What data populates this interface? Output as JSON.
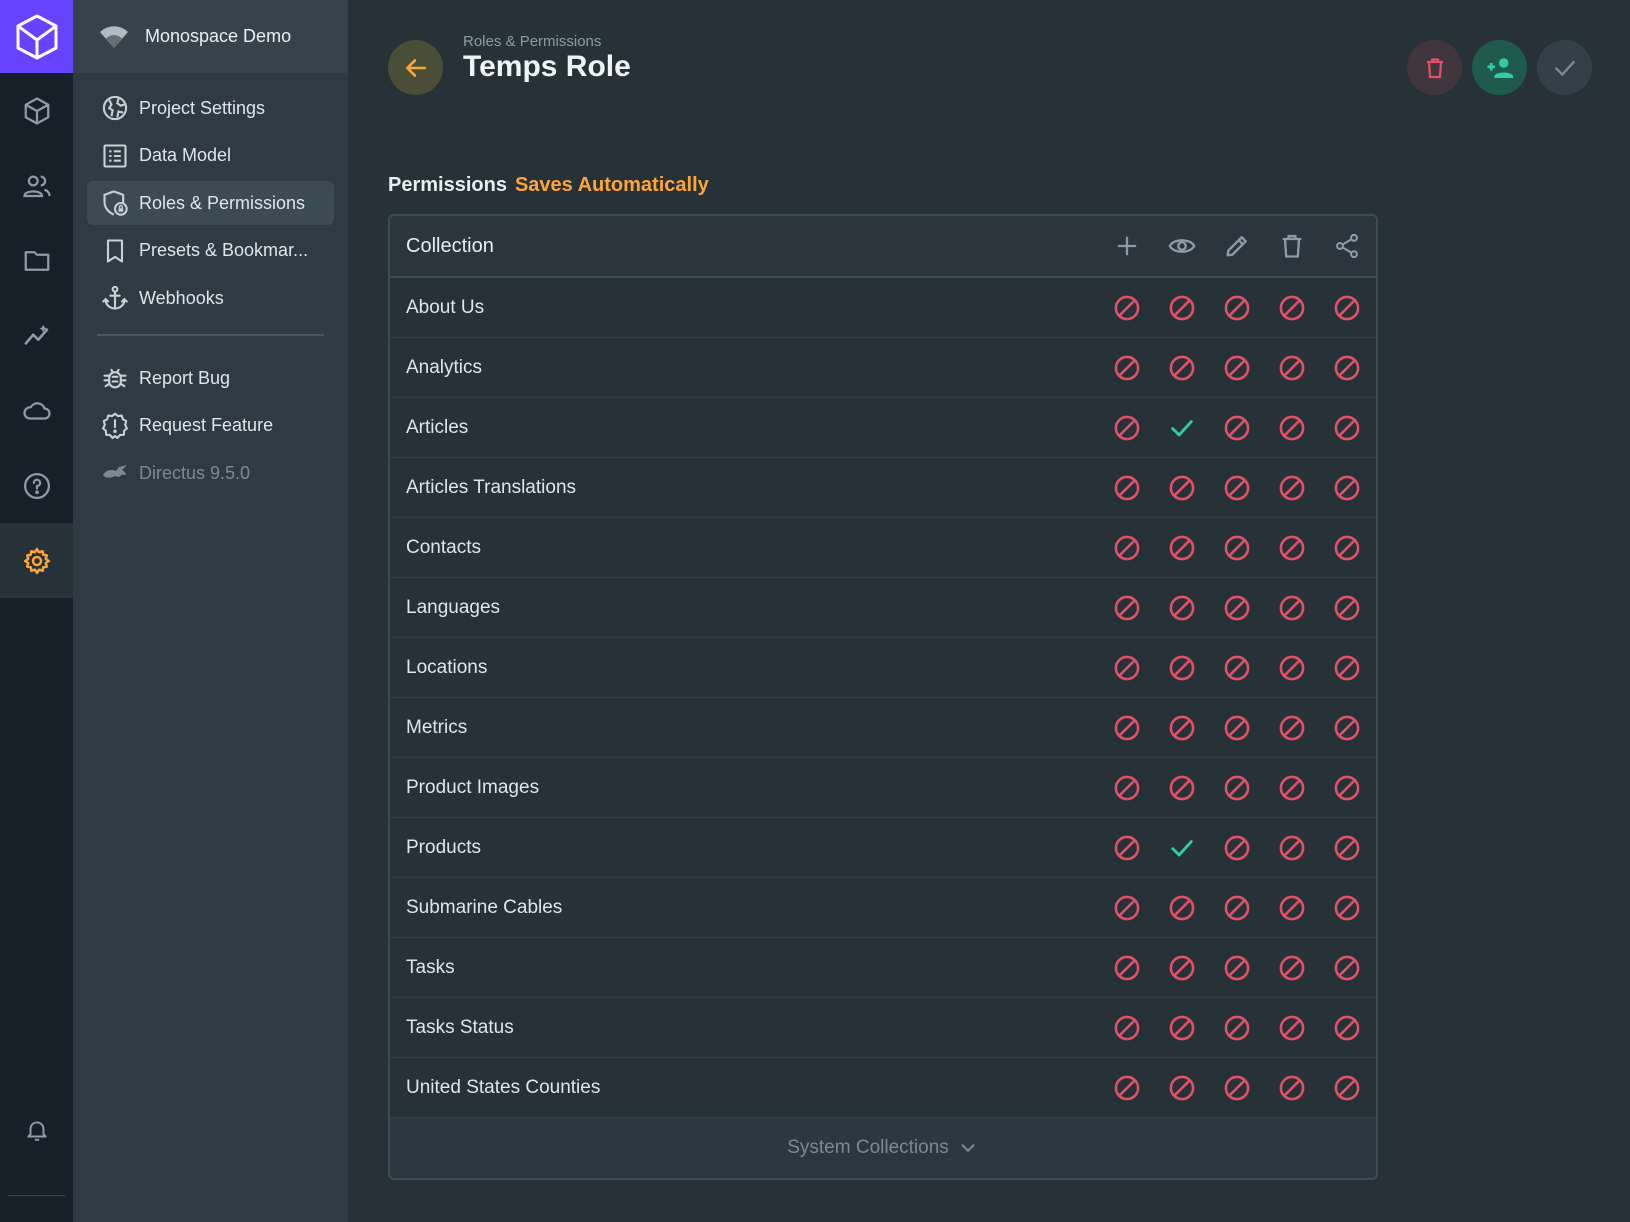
{
  "project": {
    "name": "Monospace Demo"
  },
  "modules": [
    {
      "name": "content",
      "icon": "box-icon"
    },
    {
      "name": "users",
      "icon": "users-icon"
    },
    {
      "name": "files",
      "icon": "folder-icon"
    },
    {
      "name": "insights",
      "icon": "insights-icon"
    },
    {
      "name": "cloud",
      "icon": "cloud-icon"
    },
    {
      "name": "help",
      "icon": "help-icon"
    },
    {
      "name": "settings",
      "icon": "gear-icon"
    }
  ],
  "nav": {
    "items": [
      {
        "label": "Project Settings",
        "icon": "globe-icon"
      },
      {
        "label": "Data Model",
        "icon": "list-alt-icon"
      },
      {
        "label": "Roles & Permissions",
        "icon": "shield-lock-icon"
      },
      {
        "label": "Presets & Bookmar...",
        "icon": "bookmark-icon"
      },
      {
        "label": "Webhooks",
        "icon": "anchor-icon"
      }
    ],
    "extra": [
      {
        "label": "Report Bug",
        "icon": "bug-icon"
      },
      {
        "label": "Request Feature",
        "icon": "feature-icon"
      }
    ],
    "version": "Directus 9.5.0"
  },
  "header": {
    "breadcrumb": "Roles & Permissions",
    "title": "Temps Role"
  },
  "permissions": {
    "label": "Permissions",
    "note": "Saves Automatically",
    "column_header": "Collection",
    "rows": [
      {
        "name": "About Us",
        "create": "none",
        "read": "none",
        "update": "none",
        "delete": "none",
        "share": "none"
      },
      {
        "name": "Analytics",
        "create": "none",
        "read": "none",
        "update": "none",
        "delete": "none",
        "share": "none"
      },
      {
        "name": "Articles",
        "create": "none",
        "read": "all",
        "update": "none",
        "delete": "none",
        "share": "none"
      },
      {
        "name": "Articles Translations",
        "create": "none",
        "read": "none",
        "update": "none",
        "delete": "none",
        "share": "none"
      },
      {
        "name": "Contacts",
        "create": "none",
        "read": "none",
        "update": "none",
        "delete": "none",
        "share": "none"
      },
      {
        "name": "Languages",
        "create": "none",
        "read": "none",
        "update": "none",
        "delete": "none",
        "share": "none"
      },
      {
        "name": "Locations",
        "create": "none",
        "read": "none",
        "update": "none",
        "delete": "none",
        "share": "none"
      },
      {
        "name": "Metrics",
        "create": "none",
        "read": "none",
        "update": "none",
        "delete": "none",
        "share": "none"
      },
      {
        "name": "Product Images",
        "create": "none",
        "read": "none",
        "update": "none",
        "delete": "none",
        "share": "none"
      },
      {
        "name": "Products",
        "create": "none",
        "read": "all",
        "update": "none",
        "delete": "none",
        "share": "none"
      },
      {
        "name": "Submarine Cables",
        "create": "none",
        "read": "none",
        "update": "none",
        "delete": "none",
        "share": "none"
      },
      {
        "name": "Tasks",
        "create": "none",
        "read": "none",
        "update": "none",
        "delete": "none",
        "share": "none"
      },
      {
        "name": "Tasks Status",
        "create": "none",
        "read": "none",
        "update": "none",
        "delete": "none",
        "share": "none"
      },
      {
        "name": "United States Counties",
        "create": "none",
        "read": "none",
        "update": "none",
        "delete": "none",
        "share": "none"
      }
    ],
    "footer": "System Collections"
  },
  "colors": {
    "accent": "#ffa439",
    "danger": "#e35169",
    "success": "#2ecda7",
    "brand": "#6644ff"
  }
}
